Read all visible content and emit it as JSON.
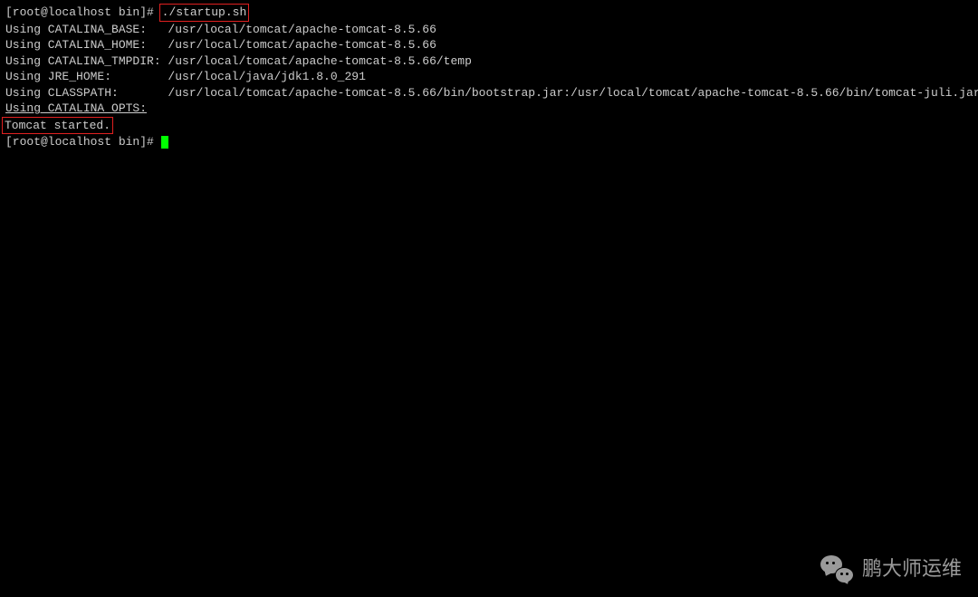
{
  "prompt1_prefix": "[root@localhost bin]# ",
  "command": "./startup.sh",
  "lines": {
    "base": "Using CATALINA_BASE:   /usr/local/tomcat/apache-tomcat-8.5.66",
    "home": "Using CATALINA_HOME:   /usr/local/tomcat/apache-tomcat-8.5.66",
    "tmpdir": "Using CATALINA_TMPDIR: /usr/local/tomcat/apache-tomcat-8.5.66/temp",
    "jre": "Using JRE_HOME:        /usr/local/java/jdk1.8.0_291",
    "classpath": "Using CLASSPATH:       /usr/local/tomcat/apache-tomcat-8.5.66/bin/bootstrap.jar:/usr/local/tomcat/apache-tomcat-8.5.66/bin/tomcat-juli.jar",
    "opts": "Using CATALINA_OPTS:"
  },
  "started": "Tomcat started.",
  "prompt2": "[root@localhost bin]# ",
  "watermark": "鹏大师运维"
}
